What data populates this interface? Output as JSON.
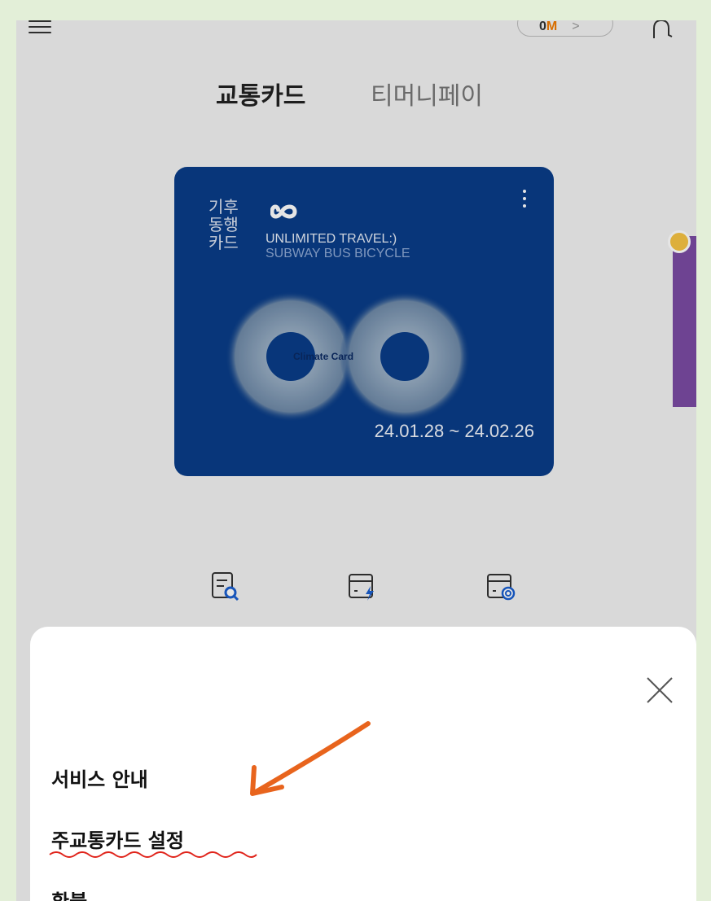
{
  "header": {
    "points_value": "0",
    "points_unit": "M",
    "points_chevron": ">"
  },
  "tabs": {
    "active": "교통카드",
    "inactive": "티머니페이"
  },
  "card": {
    "korean_title": [
      "기후",
      "동행",
      "카드"
    ],
    "line1": "UNLIMITED TRAVEL:)",
    "line2": "SUBWAY BUS BICYCLE",
    "emblem_text": "Climate Card",
    "dates": "24.01.28 ~ 24.02.26"
  },
  "sheet": {
    "items": [
      "서비스 안내",
      "주교통카드 설정",
      "환불"
    ]
  },
  "colors": {
    "card_bg": "#0a3d88",
    "tab_accent": "#8a2be2",
    "annotation": "#e8641d"
  }
}
